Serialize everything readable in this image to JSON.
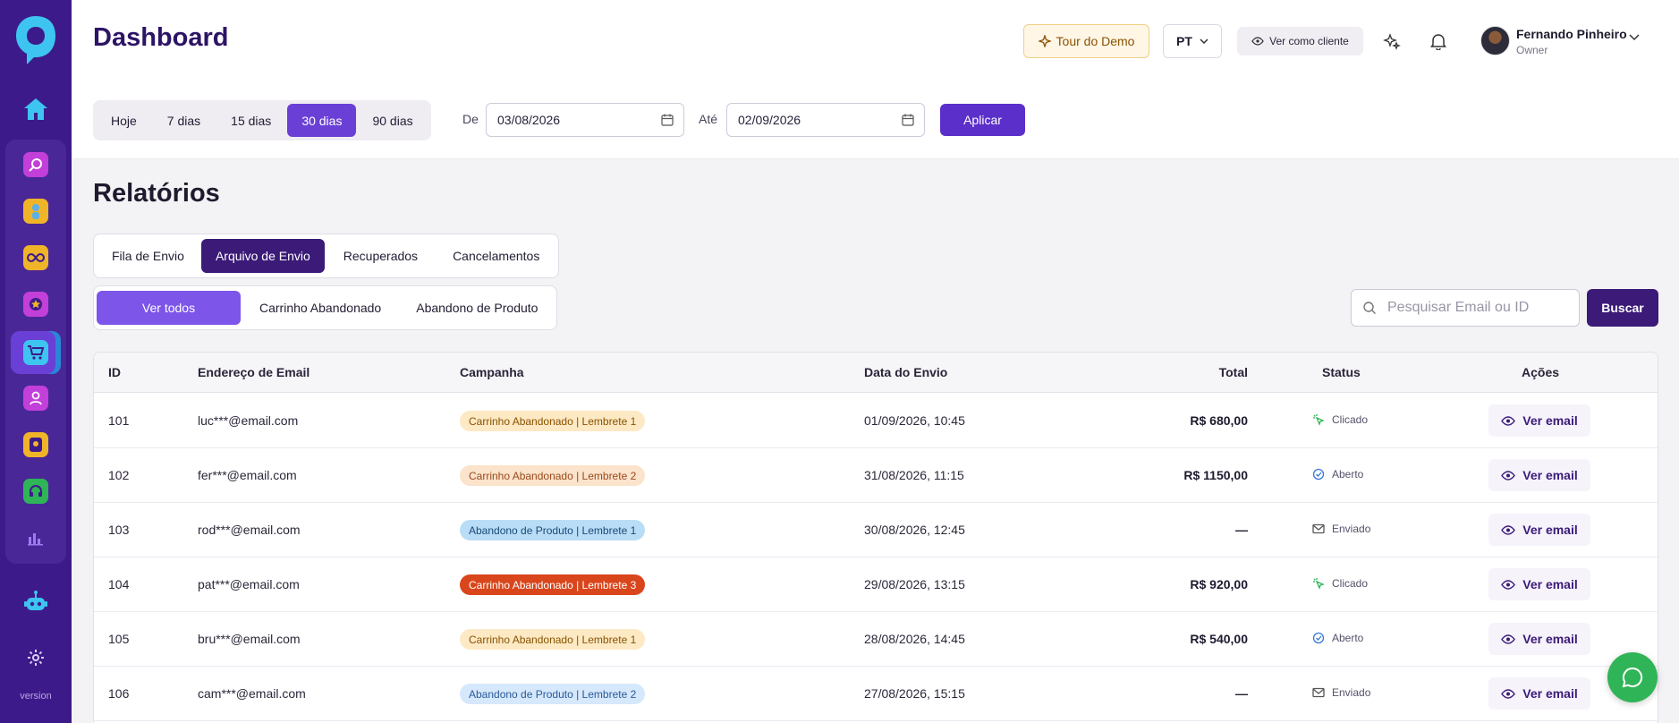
{
  "header": {
    "title": "Dashboard",
    "tour_label": "Tour do Demo",
    "lang": "PT",
    "client_view_label": "Ver como cliente",
    "user": {
      "name": "Fernando Pinheiro",
      "role": "Owner"
    }
  },
  "sidebar": {
    "version": "version"
  },
  "date_filter": {
    "ranges": [
      "Hoje",
      "7 dias",
      "15 dias",
      "30 dias",
      "90 dias"
    ],
    "active_range": "30 dias",
    "from_label": "De",
    "from_value": "03/08/2026",
    "to_label": "Até",
    "to_value": "02/09/2026",
    "apply_label": "Aplicar"
  },
  "reports": {
    "title": "Relatórios",
    "tabs": [
      "Fila de Envio",
      "Arquivo de Envio",
      "Recuperados",
      "Cancelamentos"
    ],
    "active_tab": "Arquivo de Envio",
    "subtabs": [
      "Ver todos",
      "Carrinho Abandonado",
      "Abandono de Produto"
    ],
    "active_subtab": "Ver todos",
    "search_placeholder": "Pesquisar Email ou ID",
    "search_button": "Buscar"
  },
  "table": {
    "columns": [
      "ID",
      "Endereço de Email",
      "Campanha",
      "Data do Envio",
      "Total",
      "Status",
      "Ações"
    ],
    "action_label": "Ver email",
    "rows": [
      {
        "id": "101",
        "email": "luc***@email.com",
        "campaign": "Carrinho Abandonado | Lembrete 1",
        "date": "01/09/2026, 10:45",
        "total": "R$ 680,00",
        "status": "Clicado"
      },
      {
        "id": "102",
        "email": "fer***@email.com",
        "campaign": "Carrinho Abandonado | Lembrete 2",
        "date": "31/08/2026, 11:15",
        "total": "R$ 1150,00",
        "status": "Aberto"
      },
      {
        "id": "103",
        "email": "rod***@email.com",
        "campaign": "Abandono de Produto | Lembrete 1",
        "date": "30/08/2026, 12:45",
        "total": "—",
        "status": "Enviado"
      },
      {
        "id": "104",
        "email": "pat***@email.com",
        "campaign": "Carrinho Abandonado | Lembrete 3",
        "date": "29/08/2026, 13:15",
        "total": "R$ 920,00",
        "status": "Clicado"
      },
      {
        "id": "105",
        "email": "bru***@email.com",
        "campaign": "Carrinho Abandonado | Lembrete 1",
        "date": "28/08/2026, 14:45",
        "total": "R$ 540,00",
        "status": "Aberto"
      },
      {
        "id": "106",
        "email": "cam***@email.com",
        "campaign": "Abandono de Produto | Lembrete 2",
        "date": "27/08/2026, 15:15",
        "total": "—",
        "status": "Enviado"
      }
    ]
  },
  "colors": {
    "sidebar": "#3d1a8a",
    "primary": "#5b2fc9",
    "dark_primary": "#3b1a78",
    "badge_lembrete1": "#fde9c4",
    "badge_lembrete2": "#fbe3cc",
    "badge_lembrete3": "#d9461c",
    "badge_produto1": "#b9ddf6",
    "badge_produto2": "#d6e8fb",
    "status_clicado": "#2fb457",
    "status_aberto": "#3a78d6"
  }
}
